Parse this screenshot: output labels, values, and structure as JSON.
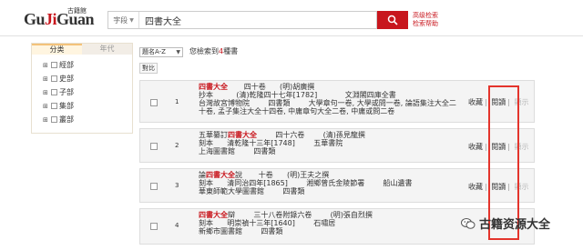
{
  "header": {
    "logo_text_a": "Gu",
    "logo_text_b": "Ji",
    "logo_text_c": "Guan",
    "logo_cn": "古籍館",
    "search_field": "字段",
    "search_value": "四書大全",
    "adv_search": "高级检索",
    "search_help": "检索帮助"
  },
  "filter": {
    "tabs": [
      "分类",
      "年代"
    ],
    "items": [
      "經部",
      "史部",
      "子部",
      "集部",
      "叢部"
    ]
  },
  "toolbar": {
    "sort": "題名A-Z",
    "summary_prefix": "您檢索到",
    "summary_count": "4",
    "summary_suffix": "種書",
    "compare": "對比"
  },
  "results": [
    {
      "num": "1",
      "lines": [
        {
          "hl": "四書大全",
          "text": "       四十卷      (明)胡廣撰"
        },
        {
          "hl": "",
          "text": "抄本          (清)乾隆四十七年[1782]            文淵閣四庫全書"
        },
        {
          "hl": "",
          "text": "台灣故宮博物院        四書類        大學章句一卷, 大學或問一卷, 論語集注大全二"
        },
        {
          "hl": "",
          "text": "十卷, 孟子集注大全十四卷, 中庸章句大全二卷, 中庸或問二卷"
        }
      ]
    },
    {
      "num": "2",
      "lines": [
        {
          "pre": "五華纂訂",
          "hl": "四書大全",
          "text": "        四十六卷        (清)孫見龍撰"
        },
        {
          "hl": "",
          "text": "刻本      清乾隆十三年[1748]        五華書院"
        },
        {
          "hl": "",
          "text": "上海圖書館        四書類"
        }
      ]
    },
    {
      "num": "3",
      "lines": [
        {
          "pre": "論",
          "hl": "四書大全",
          "post": "說",
          "text": "       十卷      (明)王夫之撰"
        },
        {
          "hl": "",
          "text": "刻本      清同治四年[1865]        湘鄉曾氏金陵節署        船山遺書"
        },
        {
          "hl": "",
          "text": "華東師範大學圖書館        四書類"
        }
      ]
    },
    {
      "num": "4",
      "lines": [
        {
          "hl": "四書大全",
          "post": "辯",
          "text": "        三十八卷附錄六卷        (明)張自烈撰"
        },
        {
          "hl": "",
          "text": "刻本      明崇禎十三年[1640]        石嘯居"
        },
        {
          "hl": "",
          "text": "新鄉市圖書館        四書類"
        }
      ]
    }
  ],
  "actions": {
    "collect": "收藏",
    "read": "閱讀",
    "display": "顯示"
  },
  "watermark": "古籍资源大全"
}
